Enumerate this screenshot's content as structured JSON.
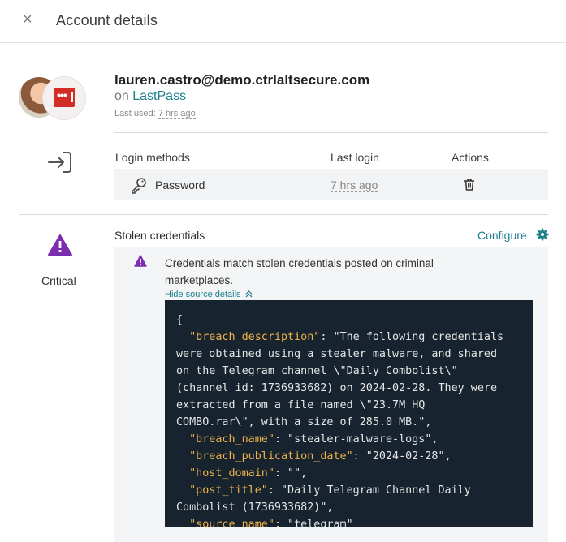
{
  "header": {
    "close_glyph": "×",
    "title": "Account details"
  },
  "account": {
    "email": "lauren.castro@demo.ctrlaltsecure.com",
    "on_prefix": "on",
    "app_name": "LastPass",
    "last_used_label": "Last used:",
    "last_used_value": "7 hrs ago"
  },
  "login": {
    "col_methods": "Login methods",
    "col_last_login": "Last login",
    "col_actions": "Actions",
    "method": "Password",
    "last_login_value": "7 hrs ago"
  },
  "stolen": {
    "section_title": "Stolen credentials",
    "configure_label": "Configure",
    "severity": "Critical",
    "message": "Credentials match stolen credentials posted on criminal marketplaces.",
    "hide_label": "Hide source details",
    "code_lines": [
      [
        "{",
        ""
      ],
      [
        "  ",
        "\"breach_description\"",
        ": \"The following credentials"
      ],
      [
        "were obtained using a stealer malware, and shared"
      ],
      [
        "on the Telegram channel \\\"Daily Combolist\\\""
      ],
      [
        "(channel id: 1736933682) on 2024-02-28. They were"
      ],
      [
        "extracted from a file named \\\"23.7M HQ"
      ],
      [
        "COMBO.rar\\\", with a size of 285.0 MB.\","
      ],
      [
        "  ",
        "\"breach_name\"",
        ": \"stealer-malware-logs\","
      ],
      [
        "  ",
        "\"breach_publication_date\"",
        ": \"2024-02-28\","
      ],
      [
        "  ",
        "\"host_domain\"",
        ": \"\","
      ],
      [
        "  ",
        "\"post_title\"",
        ": \"Daily Telegram Channel Daily"
      ],
      [
        "Combolist (1736933682)\","
      ],
      [
        "  ",
        "\"source_name\"",
        ": \"telegram\""
      ]
    ]
  },
  "colors": {
    "accent": "#1b7f8c",
    "critical": "#7b2fb0",
    "code_bg": "#17242f",
    "code_key": "#f0b34a",
    "badge_red": "#d32d27"
  },
  "icons": [
    "close-icon",
    "lastpass-logo-icon",
    "sign-in-icon",
    "key-icon",
    "trash-icon",
    "warning-triangle-icon",
    "gear-icon",
    "chevron-double-up-icon"
  ]
}
